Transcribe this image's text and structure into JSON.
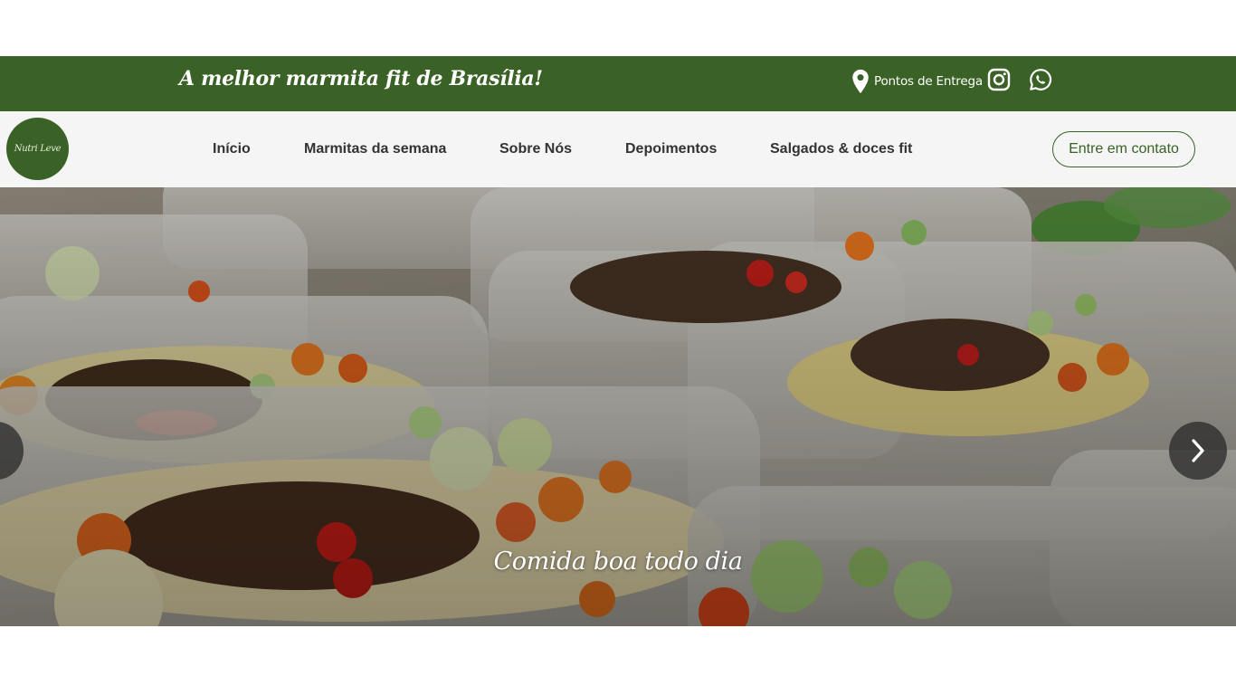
{
  "topbar": {
    "tagline": "A melhor marmita fit de Brasília!",
    "delivery_label": "Pontos de Entrega",
    "delivery_icon": "map-pin-icon",
    "instagram_icon": "instagram-icon",
    "whatsapp_icon": "whatsapp-icon",
    "background_color": "#3a6126"
  },
  "navbar": {
    "logo_text": "Nutri Leve",
    "items": [
      {
        "label": "Início"
      },
      {
        "label": "Marmitas da semana"
      },
      {
        "label": "Sobre Nós"
      },
      {
        "label": "Depoimentos"
      },
      {
        "label": "Salgados & doces fit"
      }
    ],
    "contact_button": "Entre em contato"
  },
  "hero": {
    "caption": "Comida boa todo dia",
    "next_icon": "chevron-right-icon",
    "prev_icon": "chevron-left-icon"
  }
}
